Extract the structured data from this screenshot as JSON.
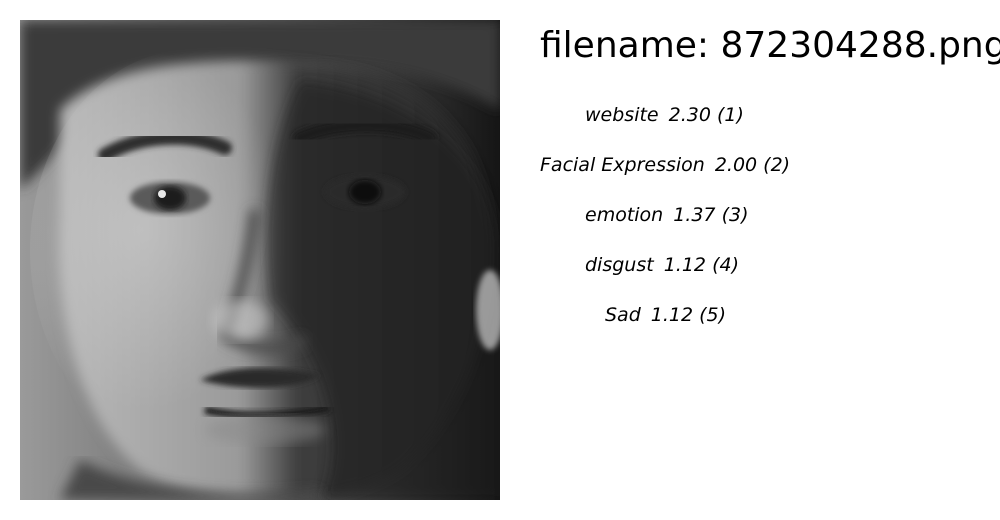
{
  "filename_line": "filename: 872304288.png",
  "image": {
    "subject": "grayscale-face-photo"
  },
  "labels": [
    {
      "name": "website",
      "score": "2.30",
      "rank": "(1)"
    },
    {
      "name": "Facial Expression",
      "score": "2.00",
      "rank": "(2)"
    },
    {
      "name": "emotion",
      "score": "1.37",
      "rank": "(3)"
    },
    {
      "name": "disgust",
      "score": "1.12",
      "rank": "(4)"
    },
    {
      "name": "Sad",
      "score": "1.12",
      "rank": "(5)"
    }
  ]
}
